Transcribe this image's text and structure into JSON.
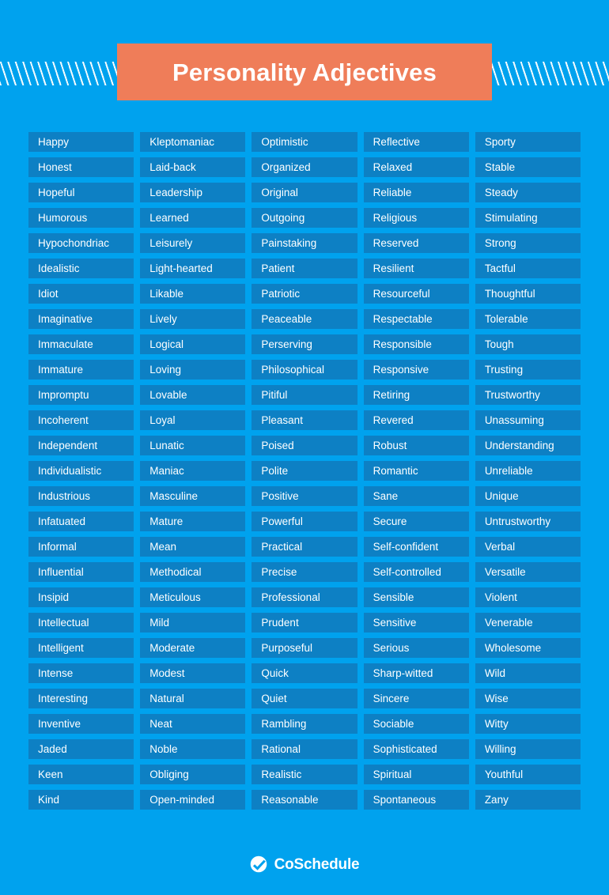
{
  "header": {
    "title": "Personality Adjectives",
    "title_bg_color": "#ef7d59",
    "page_bg_color": "#00a2ee",
    "hatch_pattern": "diagonal-slashes"
  },
  "grid": {
    "cell_bg_color": "#0d80c4",
    "cell_text_color": "#ffffff",
    "column_count": 5,
    "row_count": 27,
    "columns": [
      {
        "index": 1,
        "words": [
          "Happy",
          "Honest",
          "Hopeful",
          "Humorous",
          "Hypochondriac",
          "Idealistic",
          "Idiot",
          "Imaginative",
          "Immaculate",
          "Immature",
          "Impromptu",
          "Incoherent",
          "Independent",
          "Individualistic",
          "Industrious",
          "Infatuated",
          "Informal",
          "Influential",
          "Insipid",
          "Intellectual",
          "Intelligent",
          "Intense",
          "Interesting",
          "Inventive",
          "Jaded",
          "Keen",
          "Kind"
        ]
      },
      {
        "index": 2,
        "words": [
          "Kleptomaniac",
          "Laid-back",
          "Leadership",
          "Learned",
          "Leisurely",
          "Light-hearted",
          "Likable",
          "Lively",
          "Logical",
          "Loving",
          "Lovable",
          "Loyal",
          "Lunatic",
          "Maniac",
          "Masculine",
          "Mature",
          "Mean",
          "Methodical",
          "Meticulous",
          "Mild",
          "Moderate",
          "Modest",
          "Natural",
          "Neat",
          "Noble",
          "Obliging",
          "Open-minded"
        ]
      },
      {
        "index": 3,
        "words": [
          "Optimistic",
          "Organized",
          "Original",
          "Outgoing",
          "Painstaking",
          "Patient",
          "Patriotic",
          "Peaceable",
          "Perserving",
          "Philosophical",
          "Pitiful",
          "Pleasant",
          "Poised",
          "Polite",
          "Positive",
          "Powerful",
          "Practical",
          "Precise",
          "Professional",
          "Prudent",
          "Purposeful",
          "Quick",
          "Quiet",
          "Rambling",
          "Rational",
          "Realistic",
          "Reasonable"
        ]
      },
      {
        "index": 4,
        "words": [
          "Reflective",
          "Relaxed",
          "Reliable",
          "Religious",
          "Reserved",
          "Resilient",
          "Resourceful",
          "Respectable",
          "Responsible",
          "Responsive",
          "Retiring",
          "Revered",
          "Robust",
          "Romantic",
          "Sane",
          "Secure",
          "Self-confident",
          "Self-controlled",
          "Sensible",
          "Sensitive",
          "Serious",
          "Sharp-witted",
          "Sincere",
          "Sociable",
          "Sophisticated",
          "Spiritual",
          "Spontaneous"
        ]
      },
      {
        "index": 5,
        "words": [
          "Sporty",
          "Stable",
          "Steady",
          "Stimulating",
          "Strong",
          "Tactful",
          "Thoughtful",
          "Tolerable",
          "Tough",
          "Trusting",
          "Trustworthy",
          "Unassuming",
          "Understanding",
          "Unreliable",
          "Unique",
          "Untrustworthy",
          "Verbal",
          "Versatile",
          "Violent",
          "Venerable",
          "Wholesome",
          "Wild",
          "Wise",
          "Witty",
          "Willing",
          "Youthful",
          "Zany"
        ]
      }
    ]
  },
  "footer": {
    "brand": "CoSchedule",
    "logo_icon": "circle-check-icon"
  }
}
